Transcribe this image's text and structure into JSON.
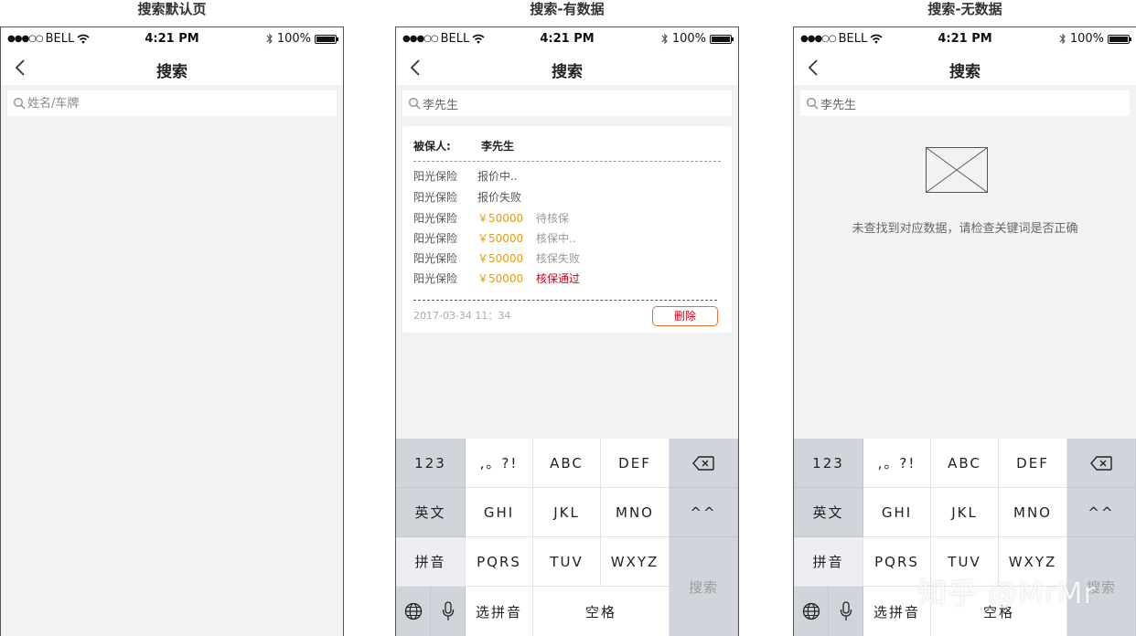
{
  "titles": [
    "搜索默认页",
    "搜索-有数据",
    "搜索-无数据"
  ],
  "status": {
    "carrier": "BELL",
    "time": "4:21 PM",
    "battery": "100%",
    "battery_level": 1.0
  },
  "nav": {
    "title": "搜索"
  },
  "search": {
    "placeholder_default": "姓名/车牌",
    "query": "李先生"
  },
  "result": {
    "insured_label": "被保人:",
    "insured_name": "李先生",
    "rows": [
      {
        "insurer": "阳光保险",
        "price": "",
        "status": "报价中..",
        "status_color": "#555555"
      },
      {
        "insurer": "阳光保险",
        "price": "",
        "status": "报价失败",
        "status_color": "#555555"
      },
      {
        "insurer": "阳光保险",
        "price": "￥50000",
        "status": "待核保",
        "status_color": "#999999"
      },
      {
        "insurer": "阳光保险",
        "price": "￥50000",
        "status": "核保中..",
        "status_color": "#999999"
      },
      {
        "insurer": "阳光保险",
        "price": "￥50000",
        "status": "核保失败",
        "status_color": "#999999"
      },
      {
        "insurer": "阳光保险",
        "price": "￥50000",
        "status": "核保通过",
        "status_color": "#d0021b"
      }
    ],
    "timestamp": "2017-03-34 11：34",
    "delete_label": "删除"
  },
  "empty": {
    "message": "未查找到对应数据，请检查关键词是否正确",
    "icon": "image-placeholder-icon"
  },
  "keyboard": {
    "k123": "123",
    "punct": ",。?!",
    "abc": "ABC",
    "def": "DEF",
    "english": "英文",
    "ghi": "GHI",
    "jkl": "JKL",
    "mno": "MNO",
    "emoji": "^^",
    "pinyin": "拼音",
    "pqrs": "PQRS",
    "tuv": "TUV",
    "wxyz": "WXYZ",
    "search": "搜索",
    "choose_pinyin": "选拼音",
    "space": "空格",
    "icons": [
      "backspace-icon",
      "globe-icon",
      "microphone-icon"
    ]
  },
  "watermark": "知乎 @MrMr",
  "colors": {
    "price": "#e79a0c",
    "status_red": "#d0021b",
    "delete_border": "#e2722a",
    "keyboard_func": "#d1d4db",
    "page_bg": "#f2f2f2"
  }
}
